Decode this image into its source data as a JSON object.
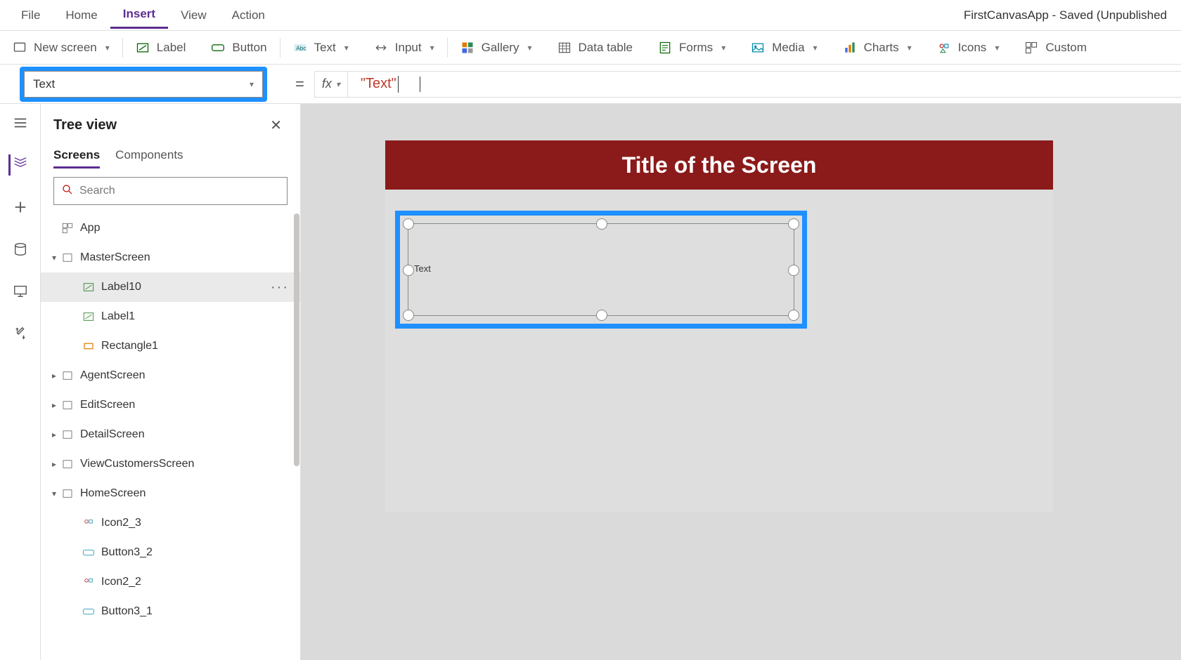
{
  "menu": {
    "file": "File",
    "home": "Home",
    "insert": "Insert",
    "view": "View",
    "action": "Action"
  },
  "app_title": "FirstCanvasApp - Saved (Unpublished",
  "ribbon": {
    "newscreen": "New screen",
    "label": "Label",
    "button": "Button",
    "text": "Text",
    "input": "Input",
    "gallery": "Gallery",
    "datatable": "Data table",
    "forms": "Forms",
    "media": "Media",
    "charts": "Charts",
    "icons": "Icons",
    "custom": "Custom"
  },
  "property_selected": "Text",
  "formula_prefix": "\"Text\"",
  "fx_label": "fx",
  "equals": "=",
  "tree": {
    "title": "Tree view",
    "tabs": {
      "screens": "Screens",
      "components": "Components"
    },
    "search_placeholder": "Search",
    "nodes": {
      "app": "App",
      "master": "MasterScreen",
      "label10": "Label10",
      "label1": "Label1",
      "rect1": "Rectangle1",
      "agent": "AgentScreen",
      "edit": "EditScreen",
      "detail": "DetailScreen",
      "viewcust": "ViewCustomersScreen",
      "home": "HomeScreen",
      "icon23": "Icon2_3",
      "btn32": "Button3_2",
      "icon22": "Icon2_2",
      "btn31": "Button3_1"
    }
  },
  "canvas": {
    "screen_title": "Title of the Screen",
    "label_text": "Text"
  }
}
